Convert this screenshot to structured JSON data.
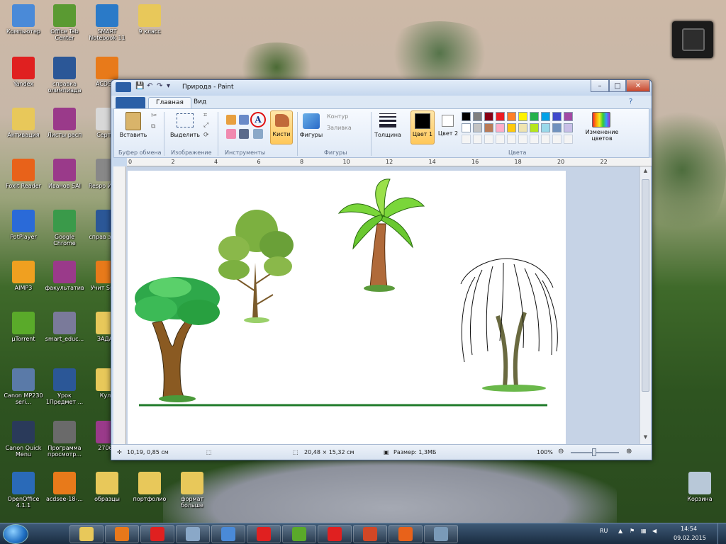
{
  "desktop": {
    "icons": [
      {
        "label": "Компьютер",
        "icon": "computer-icon",
        "color": "#4a8ad8"
      },
      {
        "label": "Office Tab Center",
        "icon": "office-tab-icon",
        "color": "#5a9a32"
      },
      {
        "label": "SMART Notebook 11",
        "icon": "smart-notebook-icon",
        "color": "#2a7ac8"
      },
      {
        "label": "9 класс",
        "icon": "folder-icon",
        "color": "#e8c85a"
      },
      {
        "label": "Yandex",
        "icon": "yandex-icon",
        "color": "#e02020"
      },
      {
        "label": "справка олимпиада",
        "icon": "word-doc-icon",
        "color": "#2b5797"
      },
      {
        "label": "ACDSee",
        "icon": "acdsee-icon",
        "color": "#e87a1a"
      },
      {
        "label": "Активация",
        "icon": "folder-icon",
        "color": "#e8c85a"
      },
      {
        "label": "Листы расп",
        "icon": "winrar-icon",
        "color": "#9a3a8a"
      },
      {
        "label": "Сертис",
        "icon": "document-icon",
        "color": "#d8d8d8"
      },
      {
        "label": "Foxit Reader",
        "icon": "foxit-icon",
        "color": "#e8621a"
      },
      {
        "label": "Иванов SAI",
        "icon": "winrar-icon",
        "color": "#9a3a8a"
      },
      {
        "label": "Respo Инсти",
        "icon": "calculator-icon",
        "color": "#888888"
      },
      {
        "label": "PotPlayer",
        "icon": "potplayer-icon",
        "color": "#2a6ad8"
      },
      {
        "label": "Google Chrome",
        "icon": "chrome-icon",
        "color": "#3a9a4a"
      },
      {
        "label": "справ завед",
        "icon": "word-doc-icon",
        "color": "#2b5797"
      },
      {
        "label": "AIMP3",
        "icon": "aimp-icon",
        "color": "#f0a020"
      },
      {
        "label": "факультатив",
        "icon": "winrar-icon",
        "color": "#9a3a8a"
      },
      {
        "label": "Учит Smart",
        "icon": "smart-icon",
        "color": "#e87a1a"
      },
      {
        "label": "µTorrent",
        "icon": "utorrent-icon",
        "color": "#5aaa2a"
      },
      {
        "label": "smart_educ...",
        "icon": "smart-educ-icon",
        "color": "#7a7a9a"
      },
      {
        "label": "ЗАДАН",
        "icon": "folder-icon",
        "color": "#e8c85a"
      },
      {
        "label": "Canon MP230 seri...",
        "icon": "canon-printer-icon",
        "color": "#5a7aa8"
      },
      {
        "label": "Урок 1Предмет ...",
        "icon": "word-doc-icon",
        "color": "#2b5797"
      },
      {
        "label": "Куле",
        "icon": "folder-icon",
        "color": "#e8c85a"
      },
      {
        "label": "Canon Quick Menu",
        "icon": "canon-quick-menu-icon",
        "color": "#2a3a5a"
      },
      {
        "label": "Программа просмотр...",
        "icon": "program-viewer-icon",
        "color": "#6a6a6a"
      },
      {
        "label": "27065",
        "icon": "winrar-icon",
        "color": "#9a3a8a"
      },
      {
        "label": "OpenOffice 4.1.1",
        "icon": "openoffice-icon",
        "color": "#2a6ab8"
      },
      {
        "label": "acdsee-18-...",
        "icon": "acdsee-icon",
        "color": "#e87a1a"
      },
      {
        "label": "образцы",
        "icon": "folder-icon",
        "color": "#e8c85a"
      },
      {
        "label": "портфолио",
        "icon": "folder-icon",
        "color": "#e8c85a"
      },
      {
        "label": "формат больше",
        "icon": "folder-icon",
        "color": "#e8c85a"
      },
      {
        "label": "Корзина",
        "icon": "recycle-bin-icon",
        "color": "#b8c8d8"
      }
    ]
  },
  "window": {
    "title": "Природа - Paint",
    "tabs": {
      "home": "Главная",
      "view": "Вид"
    },
    "ribbon": {
      "paste": "Вставить",
      "select": "Выделить",
      "brushes": "Кисти",
      "shapes": "Фигуры",
      "outline": "Контур",
      "fill": "Заливка",
      "thickness": "Толщина",
      "color1": "Цвет 1",
      "color2": "Цвет 2",
      "edit_colors": "Изменение цветов",
      "groups": {
        "clipboard": "Буфер обмена",
        "image": "Изображение",
        "tools": "Инструменты",
        "shapes": "Фигуры",
        "colors": "Цвета"
      },
      "palette_row1": [
        "#000000",
        "#7f7f7f",
        "#880015",
        "#ed1c24",
        "#ff7f27",
        "#fff200",
        "#22b14c",
        "#00a2e8",
        "#3f48cc",
        "#a349a4"
      ],
      "palette_row2": [
        "#ffffff",
        "#c3c3c3",
        "#b97a57",
        "#ffaec9",
        "#ffc90e",
        "#efe4b0",
        "#b5e61d",
        "#99d9ea",
        "#7092be",
        "#c8bfe7"
      ],
      "color1_value": "#000000",
      "color2_value": "#ffffff"
    },
    "ruler": [
      "0",
      "2",
      "4",
      "6",
      "8",
      "10",
      "12",
      "14",
      "16",
      "18",
      "20",
      "22"
    ],
    "status": {
      "cursor": "10,19, 0,85 см",
      "dimensions": "20,48 × 15,32 см",
      "size": "Размер: 1,3МБ",
      "zoom": "100%"
    }
  },
  "taskbar": {
    "apps": [
      {
        "icon": "explorer-icon",
        "color": "#e8c85a"
      },
      {
        "icon": "media-player-icon",
        "color": "#e8781a"
      },
      {
        "icon": "yandex-browser-icon",
        "color": "#e02020"
      },
      {
        "icon": "calculator-icon",
        "color": "#8aa8c8"
      },
      {
        "icon": "speaker-icon",
        "color": "#4a8ad8"
      },
      {
        "icon": "yandex-search-icon",
        "color": "#e02020"
      },
      {
        "icon": "utorrent-icon",
        "color": "#5aaa2a"
      },
      {
        "icon": "yandex-icon",
        "color": "#e02020"
      },
      {
        "icon": "powerpoint-icon",
        "color": "#d24726"
      },
      {
        "icon": "foxit-icon",
        "color": "#e8621a"
      },
      {
        "icon": "paint-icon",
        "color": "#7a9ab8"
      }
    ],
    "language": "RU",
    "time": "14:54",
    "date": "09.02.2015"
  }
}
